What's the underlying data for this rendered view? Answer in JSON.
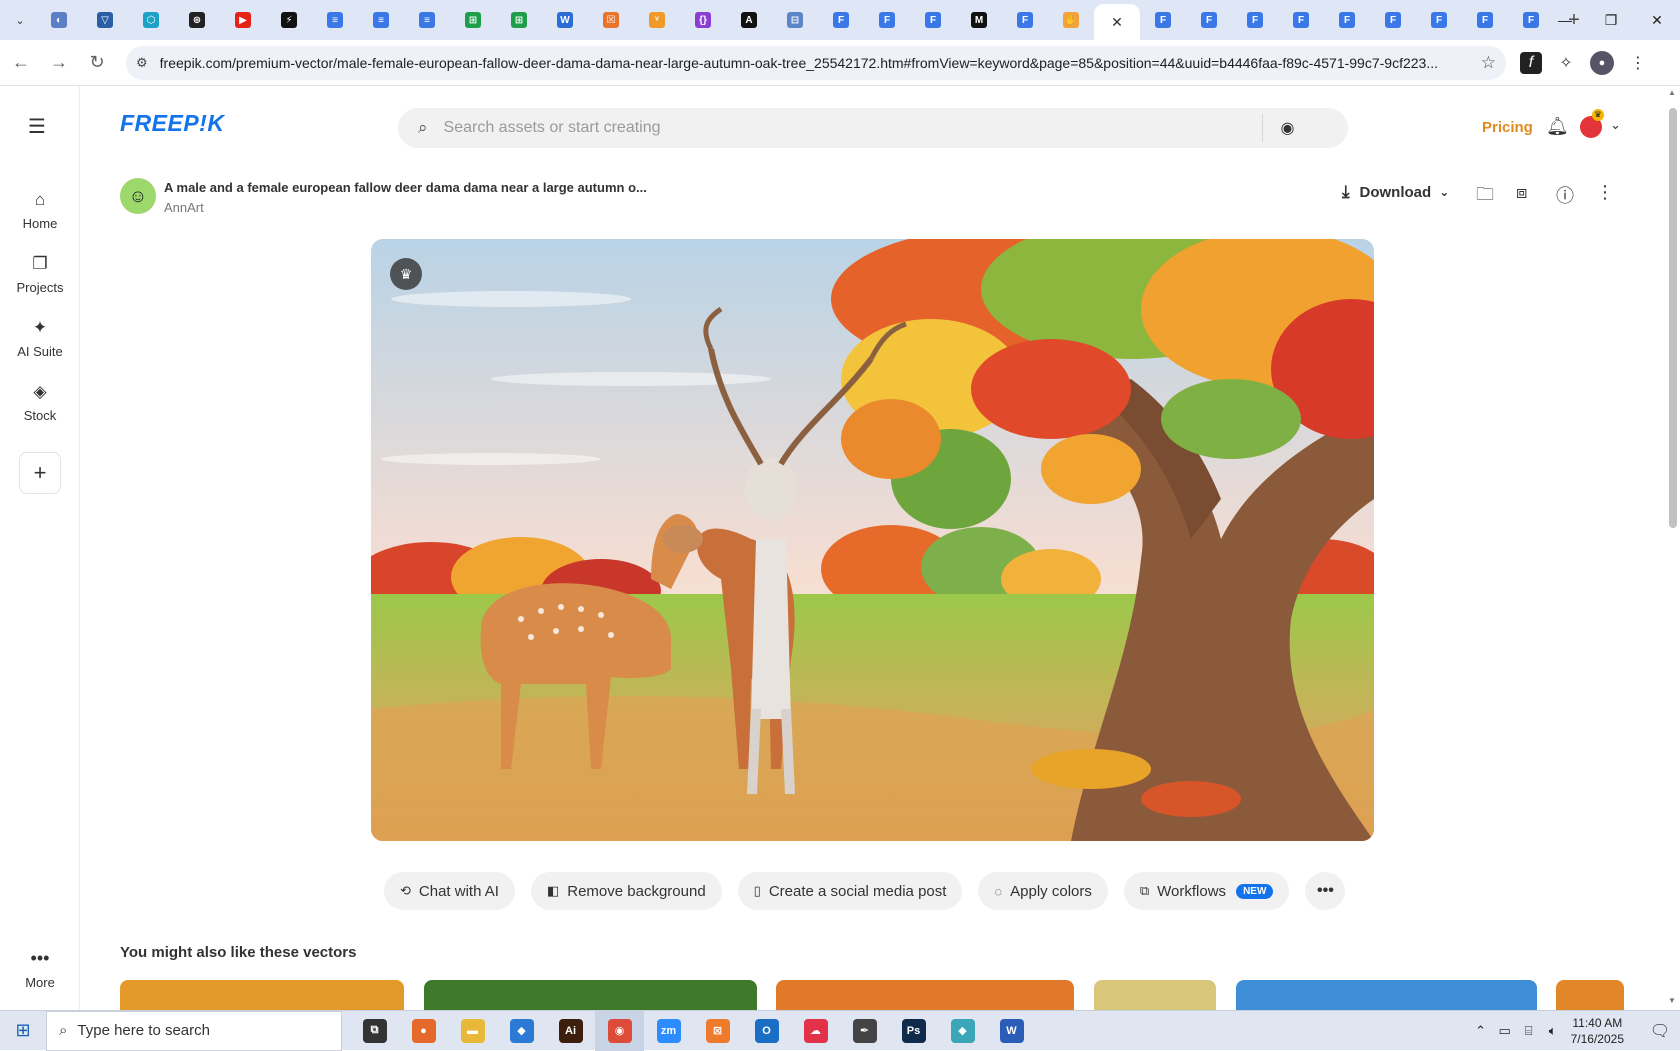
{
  "browser": {
    "pinned_tabs": [
      {
        "icon": "globe-icon",
        "color": "#5b7fc7",
        "glyph": "◐"
      },
      {
        "icon": "vector-icon",
        "color": "#2a5fa8",
        "glyph": "▽"
      },
      {
        "icon": "hex-icon",
        "color": "#1da1c7",
        "glyph": "⬡"
      },
      {
        "icon": "openai-icon",
        "color": "#222222",
        "glyph": "⊛"
      },
      {
        "icon": "youtube-icon",
        "color": "#e62117",
        "glyph": "▶"
      },
      {
        "icon": "bolt-icon",
        "color": "#111111",
        "glyph": "⚡"
      },
      {
        "icon": "docs-icon",
        "color": "#3b78e7",
        "glyph": "≡"
      },
      {
        "icon": "docs-icon",
        "color": "#3b78e7",
        "glyph": "≡"
      },
      {
        "icon": "docs-icon",
        "color": "#3b78e7",
        "glyph": "≡"
      },
      {
        "icon": "sheets-icon",
        "color": "#1e9e4a",
        "glyph": "⊞"
      },
      {
        "icon": "sheets-icon",
        "color": "#1e9e4a",
        "glyph": "⊞"
      },
      {
        "icon": "word-icon",
        "color": "#2b6fd6",
        "glyph": "W"
      },
      {
        "icon": "box-icon",
        "color": "#e8742c",
        "glyph": "☒"
      },
      {
        "icon": "fox-icon",
        "color": "#f19a2a",
        "glyph": "ᵛ"
      },
      {
        "icon": "code-icon",
        "color": "#8a3fd1",
        "glyph": "{}"
      },
      {
        "icon": "a-icon",
        "color": "#111111",
        "glyph": "A"
      },
      {
        "icon": "table-icon",
        "color": "#5c86c7",
        "glyph": "⊟"
      },
      {
        "icon": "forms-icon",
        "color": "#3b78e7",
        "glyph": "F"
      },
      {
        "icon": "forms-icon",
        "color": "#3b78e7",
        "glyph": "F"
      },
      {
        "icon": "forms-icon",
        "color": "#3b78e7",
        "glyph": "F"
      },
      {
        "icon": "m-icon",
        "color": "#111111",
        "glyph": "M"
      },
      {
        "icon": "forms-icon",
        "color": "#3b78e7",
        "glyph": "F"
      },
      {
        "icon": "hand-icon",
        "color": "#f0a33c",
        "glyph": "✋"
      }
    ],
    "active_tab_close": "✕",
    "trailing_tabs": [
      {
        "icon": "forms-icon",
        "color": "#3b78e7",
        "glyph": "F"
      },
      {
        "icon": "forms-icon",
        "color": "#3b78e7",
        "glyph": "F"
      },
      {
        "icon": "forms-icon",
        "color": "#3b78e7",
        "glyph": "F"
      },
      {
        "icon": "forms-icon",
        "color": "#3b78e7",
        "glyph": "F"
      },
      {
        "icon": "forms-icon",
        "color": "#3b78e7",
        "glyph": "F"
      },
      {
        "icon": "forms-icon",
        "color": "#3b78e7",
        "glyph": "F"
      },
      {
        "icon": "forms-icon",
        "color": "#3b78e7",
        "glyph": "F"
      },
      {
        "icon": "forms-icon",
        "color": "#3b78e7",
        "glyph": "F"
      },
      {
        "icon": "forms-icon",
        "color": "#3b78e7",
        "glyph": "F"
      }
    ],
    "new_tab": "+",
    "url": "freepik.com/premium-vector/male-female-european-fallow-deer-dama-dama-near-large-autumn-oak-tree_25542172.htm#fromView=keyword&page=85&position=44&uuid=b4446faa-f89c-4571-99c7-9cf223..."
  },
  "header": {
    "logo": "FREEP!K",
    "search_placeholder": "Search assets or start creating",
    "pricing": "Pricing"
  },
  "sidebar": {
    "items": [
      {
        "label": "Home",
        "icon": "home-icon",
        "glyph": "⌂"
      },
      {
        "label": "Projects",
        "icon": "projects-icon",
        "glyph": "❐"
      },
      {
        "label": "AI Suite",
        "icon": "sparkle-icon",
        "glyph": "✦"
      },
      {
        "label": "Stock",
        "icon": "stock-icon",
        "glyph": "◈"
      }
    ],
    "add": "+",
    "more_label": "More"
  },
  "asset": {
    "title": "A male and a female european fallow deer dama dama near a large autumn o...",
    "author": "AnnArt",
    "download_label": "Download"
  },
  "actions": [
    {
      "label": "Chat with AI",
      "icon": "chat-icon",
      "glyph": "⟲"
    },
    {
      "label": "Remove background",
      "icon": "remove-bg-icon",
      "glyph": "◧"
    },
    {
      "label": "Create a social media post",
      "icon": "phone-icon",
      "glyph": "▯"
    },
    {
      "label": "Apply colors",
      "icon": "palette-icon",
      "glyph": "◌"
    },
    {
      "label": "Workflows",
      "icon": "workflow-icon",
      "glyph": "⧉",
      "badge": "NEW"
    }
  ],
  "related": {
    "title": "You might also like these vectors",
    "thumbs": [
      {
        "color": "#e39a2a"
      },
      {
        "color": "#3f7a2c"
      },
      {
        "color": "#e07a2a"
      },
      {
        "color": "#d8c67a"
      },
      {
        "color": "#3d8ed6"
      },
      {
        "color": "#e2862a"
      }
    ]
  },
  "taskbar": {
    "search_text": "Type here to search",
    "apps": [
      {
        "icon": "task-view-icon",
        "glyph": "⧉",
        "color": "#333333"
      },
      {
        "icon": "firefox-icon",
        "glyph": "●",
        "color": "#e5692b"
      },
      {
        "icon": "explorer-icon",
        "glyph": "▬",
        "color": "#e8b83a"
      },
      {
        "icon": "vscode-icon",
        "glyph": "◆",
        "color": "#2b7bd6"
      },
      {
        "icon": "illustrator-icon",
        "glyph": "Ai",
        "color": "#3c1f0d"
      },
      {
        "icon": "chrome-icon",
        "glyph": "◉",
        "color": "#dd4b39"
      },
      {
        "icon": "zoom-icon",
        "glyph": "zm",
        "color": "#2d8cff"
      },
      {
        "icon": "xampp-icon",
        "glyph": "⊠",
        "color": "#f07a2c"
      },
      {
        "icon": "outlook-icon",
        "glyph": "O",
        "color": "#1a6fc4"
      },
      {
        "icon": "creative-cloud-icon",
        "glyph": "☁",
        "color": "#e2324a"
      },
      {
        "icon": "pen-icon",
        "glyph": "✒",
        "color": "#444444"
      },
      {
        "icon": "photoshop-icon",
        "glyph": "Ps",
        "color": "#0f2a4a"
      },
      {
        "icon": "app-icon",
        "glyph": "◆",
        "color": "#3aa7b8"
      },
      {
        "icon": "word-icon",
        "glyph": "W",
        "color": "#2b5cb8"
      }
    ],
    "time": "11:40 AM",
    "date": "7/16/2025"
  }
}
